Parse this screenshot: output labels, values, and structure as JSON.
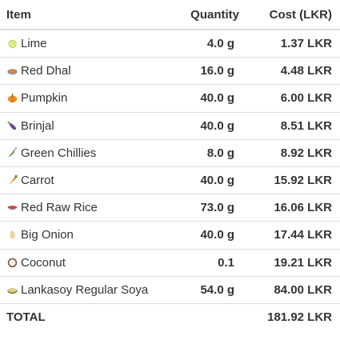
{
  "table": {
    "headers": {
      "item": "Item",
      "quantity": "Quantity",
      "cost": "Cost (LKR)"
    },
    "rows": [
      {
        "item": "Lime",
        "icon": "lime-icon",
        "quantity": "4.0 g",
        "cost": "1.37 LKR"
      },
      {
        "item": "Red Dhal",
        "icon": "red-dhal-icon",
        "quantity": "16.0 g",
        "cost": "4.48 LKR"
      },
      {
        "item": "Pumpkin",
        "icon": "pumpkin-icon",
        "quantity": "40.0 g",
        "cost": "6.00 LKR"
      },
      {
        "item": "Brinjal",
        "icon": "brinjal-icon",
        "quantity": "40.0 g",
        "cost": "8.51 LKR"
      },
      {
        "item": "Green Chillies",
        "icon": "green-chilli-icon",
        "quantity": "8.0 g",
        "cost": "8.92 LKR"
      },
      {
        "item": "Carrot",
        "icon": "carrot-icon",
        "quantity": "40.0 g",
        "cost": "15.92 LKR"
      },
      {
        "item": "Red Raw Rice",
        "icon": "red-rice-icon",
        "quantity": "73.0 g",
        "cost": "16.06 LKR"
      },
      {
        "item": "Big Onion",
        "icon": "onion-icon",
        "quantity": "40.0 g",
        "cost": "17.44 LKR"
      },
      {
        "item": "Coconut",
        "icon": "coconut-icon",
        "quantity": "0.1",
        "cost": "19.21 LKR"
      },
      {
        "item": "Lankasoy Regular Soya",
        "icon": "soya-icon",
        "quantity": "54.0 g",
        "cost": "84.00 LKR"
      }
    ],
    "total": {
      "label": "TOTAL",
      "cost": "181.92 LKR"
    }
  }
}
